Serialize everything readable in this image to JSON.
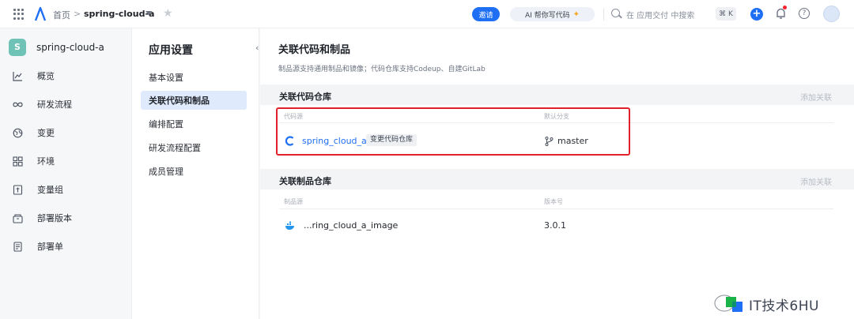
{
  "topbar": {
    "breadcrumb_home": "首页",
    "breadcrumb_sep": ">",
    "app_name": "spring-cloud-a",
    "invite_label": "邀请",
    "ai_label": "AI 帮你写代码",
    "search_placeholder": "在 应用交付 中搜索",
    "shortcut": "⌘ K",
    "accent": "#1f6ff5"
  },
  "sidebar": {
    "app_badge": "S",
    "app_name": "spring-cloud-a",
    "items": [
      {
        "label": "概览",
        "icon": "chart-line-icon"
      },
      {
        "label": "研发流程",
        "icon": "infinity-icon"
      },
      {
        "label": "变更",
        "icon": "globe-icon"
      },
      {
        "label": "环境",
        "icon": "grid-icon"
      },
      {
        "label": "变量组",
        "icon": "variable-icon"
      },
      {
        "label": "部署版本",
        "icon": "package-icon"
      },
      {
        "label": "部署单",
        "icon": "document-icon"
      }
    ]
  },
  "settings": {
    "title": "应用设置",
    "items": [
      {
        "label": "基本设置",
        "active": false
      },
      {
        "label": "关联代码和制品",
        "active": true
      },
      {
        "label": "编排配置",
        "active": false
      },
      {
        "label": "研发流程配置",
        "active": false
      },
      {
        "label": "成员管理",
        "active": false
      }
    ]
  },
  "main": {
    "title": "关联代码和制品",
    "description": "制品源支持通用制品和镜像；代码仓库支持Codeup、自建GitLab",
    "code_section": {
      "title": "关联代码仓库",
      "action": "添加关联",
      "col_source": "代码源",
      "col_branch": "默认分支",
      "repo_name": "spring_cloud_a",
      "change_tag": "变更代码仓库",
      "branch": "master"
    },
    "artifact_section": {
      "title": "关联制品仓库",
      "action": "添加关联",
      "col_source": "制品源",
      "col_version": "版本号",
      "image_name": "...ring_cloud_a_image",
      "version": "3.0.1"
    }
  },
  "watermark": {
    "text": "IT技术6HU"
  }
}
